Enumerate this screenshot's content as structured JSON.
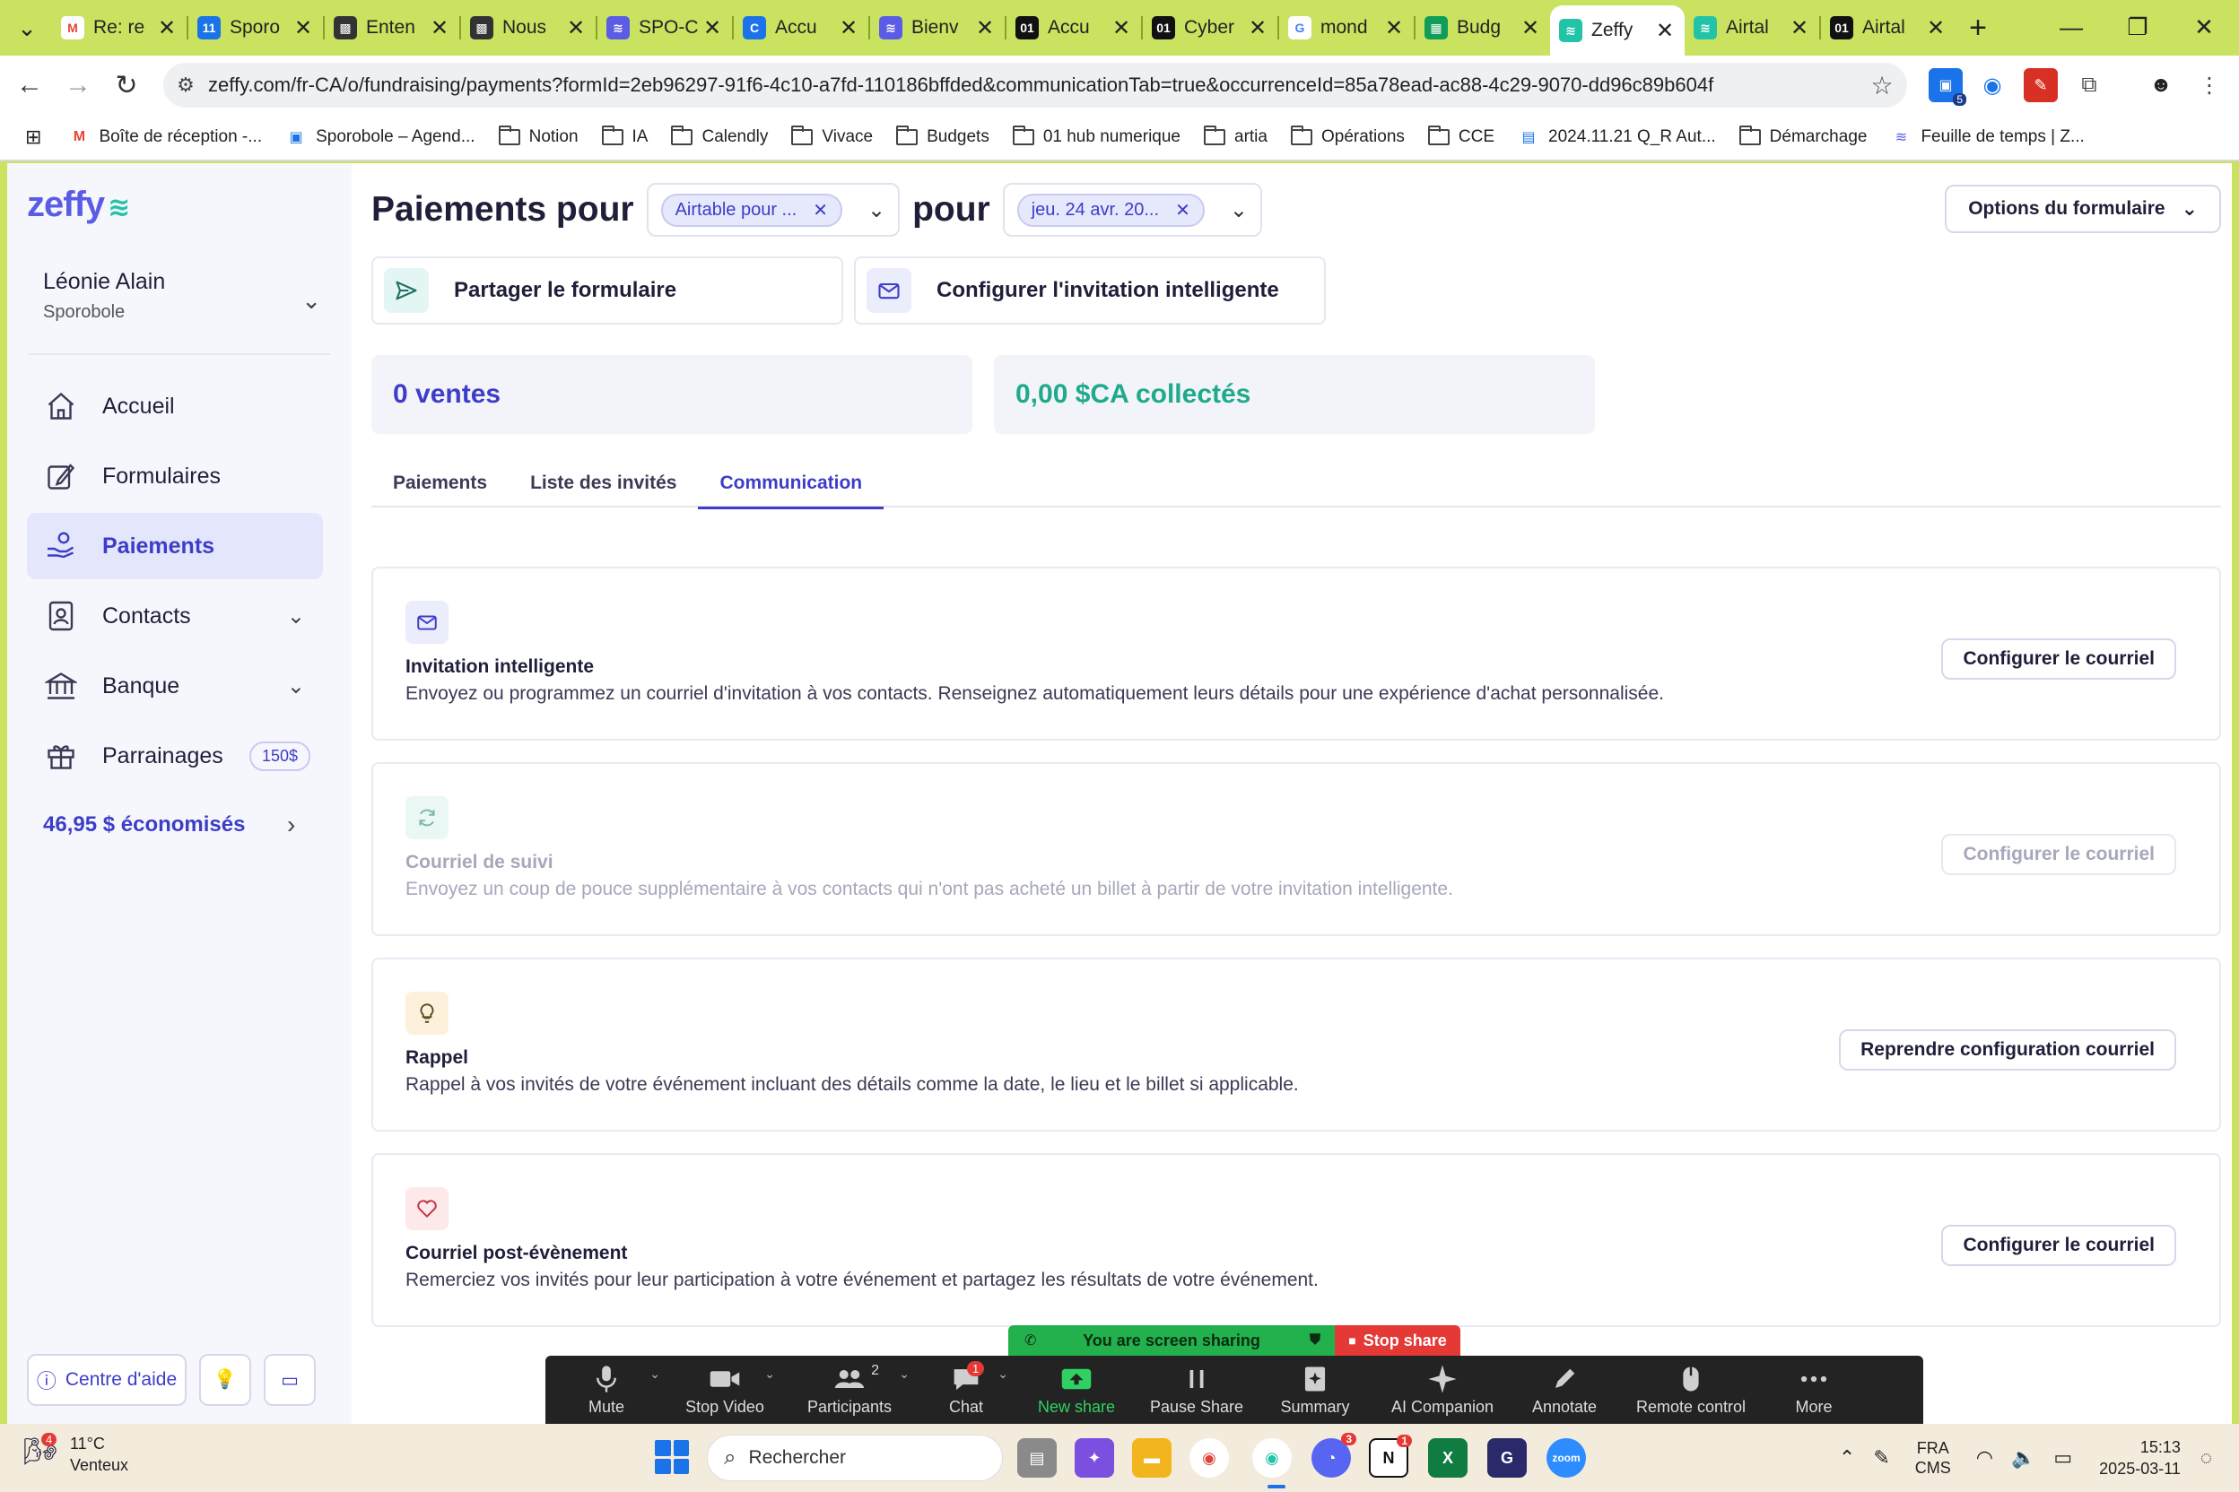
{
  "browser": {
    "tabs": [
      {
        "title": "Re: re",
        "fav": "gmail-icon",
        "color": "#ffffff"
      },
      {
        "title": "Sporo",
        "fav": "calendar-icon",
        "color": "#1a73e8"
      },
      {
        "title": "Enten",
        "fav": "movie-icon",
        "color": "#333333"
      },
      {
        "title": "Nous",
        "fav": "movie-icon",
        "color": "#333333"
      },
      {
        "title": "SPO-C",
        "fav": "zeffy-icon",
        "color": "#5b5ce6"
      },
      {
        "title": "Accu",
        "fav": "c-icon",
        "color": "#1a73e8"
      },
      {
        "title": "Bienv",
        "fav": "zeffy-icon",
        "color": "#5b5ce6"
      },
      {
        "title": "Accu",
        "fav": "01-icon",
        "color": "#111111"
      },
      {
        "title": "Cyber",
        "fav": "01-icon",
        "color": "#111111"
      },
      {
        "title": "mond",
        "fav": "google-icon",
        "color": "#ffffff"
      },
      {
        "title": "Budg",
        "fav": "sheets-icon",
        "color": "#0f9d58"
      },
      {
        "title": "Zeffy",
        "fav": "zeffy-icon",
        "color": "#22c3a6"
      },
      {
        "title": "Airtal",
        "fav": "zeffy-icon",
        "color": "#22c3a6"
      },
      {
        "title": "Airtal",
        "fav": "01-icon",
        "color": "#111111"
      }
    ],
    "active_tab": 11,
    "close_glyph": "✕",
    "new_tab": "+",
    "url": "zeffy.com/fr-CA/o/fundraising/payments?formId=2eb96297-91f6-4c10-a7fd-110186bffded&communicationTab=true&occurrenceId=85a78ead-ac88-4c29-9070-dd96c89b604f",
    "extension_badge": "5",
    "bookmarks": [
      {
        "label": "Boîte de réception -...",
        "icon": "gmail-icon"
      },
      {
        "label": "Sporobole – Agend...",
        "icon": "calendar-icon"
      },
      {
        "label": "Notion",
        "icon": "folder-icon"
      },
      {
        "label": "IA",
        "icon": "folder-icon"
      },
      {
        "label": "Calendly",
        "icon": "folder-icon"
      },
      {
        "label": "Vivace",
        "icon": "folder-icon"
      },
      {
        "label": "Budgets",
        "icon": "folder-icon"
      },
      {
        "label": "01 hub numerique",
        "icon": "folder-icon"
      },
      {
        "label": "artia",
        "icon": "folder-icon"
      },
      {
        "label": "Opérations",
        "icon": "folder-icon"
      },
      {
        "label": "CCE",
        "icon": "folder-icon"
      },
      {
        "label": "2024.11.21 Q_R Aut...",
        "icon": "docs-icon"
      },
      {
        "label": "Démarchage",
        "icon": "folder-icon"
      },
      {
        "label": "Feuille de temps | Z...",
        "icon": "zeffy-icon"
      }
    ]
  },
  "sidebar": {
    "logo": "zeffy",
    "user_name": "Léonie Alain",
    "org_name": "Sporobole",
    "items": [
      {
        "label": "Accueil",
        "icon": "home-icon",
        "chevron": false
      },
      {
        "label": "Formulaires",
        "icon": "edit-icon",
        "chevron": false
      },
      {
        "label": "Paiements",
        "icon": "hand-coin-icon",
        "chevron": false
      },
      {
        "label": "Contacts",
        "icon": "contact-icon",
        "chevron": true
      },
      {
        "label": "Banque",
        "icon": "bank-icon",
        "chevron": true
      },
      {
        "label": "Parrainages",
        "icon": "gift-icon",
        "chevron": false,
        "badge": "150$"
      }
    ],
    "active_item": 2,
    "savings": "46,95 $ économisés",
    "help_label": "Centre d'aide"
  },
  "header": {
    "title_prefix": "Paiements pour",
    "form_chip": "Airtable pour ...",
    "title_middle": "pour",
    "date_chip": "jeu. 24 avr. 20...",
    "form_options": "Options du formulaire"
  },
  "actions": {
    "share": "Partager le formulaire",
    "configure_invite": "Configurer l'invitation intelligente"
  },
  "stats": {
    "sales": "0 ventes",
    "collected": "0,00 $CA collectés"
  },
  "tabs": [
    {
      "label": "Paiements"
    },
    {
      "label": "Liste des invités"
    },
    {
      "label": "Communication"
    }
  ],
  "active_page_tab": 2,
  "communications": [
    {
      "title": "Invitation intelligente",
      "description": "Envoyez ou programmez un courriel d'invitation à vos contacts. Renseignez automatiquement leurs détails pour une expérience d'achat personnalisée.",
      "button": "Configurer le courriel",
      "icon": "mail-icon",
      "enabled": true
    },
    {
      "title": "Courriel de suivi",
      "description": "Envoyez un coup de pouce supplémentaire à vos contacts qui n'ont pas acheté un billet à partir de votre invitation intelligente.",
      "button": "Configurer le courriel",
      "icon": "refresh-icon",
      "enabled": false
    },
    {
      "title": "Rappel",
      "description": "Rappel à vos invités de votre événement incluant des détails comme la date, le lieu et le billet si applicable.",
      "button": "Reprendre configuration courriel",
      "icon": "lightbulb-icon",
      "enabled": true
    },
    {
      "title": "Courriel post-évènement",
      "description": "Remerciez vos invités pour leur participation à votre événement et partagez les résultats de votre événement.",
      "button": "Configurer le courriel",
      "icon": "heart-icon",
      "enabled": true
    }
  ],
  "zoom": {
    "sharing_text": "You are screen sharing",
    "stop_share": "Stop share",
    "buttons": [
      {
        "label": "Mute",
        "icon": "mic-icon"
      },
      {
        "label": "Stop Video",
        "icon": "video-icon"
      },
      {
        "label": "Participants",
        "icon": "participants-icon",
        "count": "2"
      },
      {
        "label": "Chat",
        "icon": "chat-icon",
        "badge": "1"
      },
      {
        "label": "New share",
        "icon": "share-icon"
      },
      {
        "label": "Pause Share",
        "icon": "pause-icon"
      },
      {
        "label": "Summary",
        "icon": "summary-icon"
      },
      {
        "label": "AI Companion",
        "icon": "sparkle-icon"
      },
      {
        "label": "Annotate",
        "icon": "pen-icon"
      },
      {
        "label": "Remote control",
        "icon": "mouse-icon"
      },
      {
        "label": "More",
        "icon": "more-icon"
      }
    ]
  },
  "taskbar": {
    "weather_temp": "11°C",
    "weather_desc": "Venteux",
    "weather_badge": "4",
    "search": "Rechercher",
    "lang_top": "FRA",
    "lang_bottom": "CMS",
    "time": "15:13",
    "date": "2025-03-11",
    "discord_badge": "3",
    "notion_badge": "1"
  },
  "colors": {
    "brand": "#5b5ce6",
    "brand_teal": "#22c3a6",
    "stat_sales": "#3d3dc8",
    "stat_collected": "#1faa8c",
    "frame": "#c9e260"
  }
}
